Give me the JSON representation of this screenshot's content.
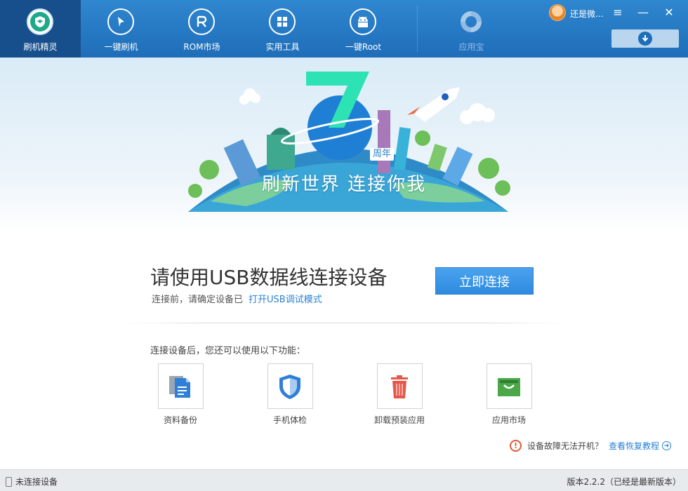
{
  "nav": {
    "items": [
      {
        "label": "刷机精灵",
        "icon": "shield-icon",
        "active": true
      },
      {
        "label": "一键刷机",
        "icon": "cursor-icon"
      },
      {
        "label": "ROM市场",
        "icon": "rom-icon"
      },
      {
        "label": "实用工具",
        "icon": "grid-icon"
      },
      {
        "label": "一键Root",
        "icon": "android-icon"
      },
      {
        "label": "应用宝",
        "icon": "app-store-icon",
        "disabled": true
      }
    ]
  },
  "user": {
    "name": "还是微..."
  },
  "window": {
    "menu": "≡",
    "minimize": "—",
    "close": "✕"
  },
  "banner": {
    "slogan": "刷新世界 连接你我",
    "anniversary_label": "周年",
    "anniversary_number": "7"
  },
  "connect": {
    "title": "请使用USB数据线连接设备",
    "subtitle": "连接前，请确定设备已",
    "link": "打开USB调试模式",
    "button": "立即连接"
  },
  "features": {
    "heading": "连接设备后，您还可以使用以下功能：",
    "items": [
      {
        "label": "资料备份",
        "icon": "document-backup-icon"
      },
      {
        "label": "手机体检",
        "icon": "shield-check-icon"
      },
      {
        "label": "卸载预装应用",
        "icon": "trash-icon"
      },
      {
        "label": "应用市场",
        "icon": "shopping-bag-icon"
      }
    ]
  },
  "help": {
    "text": "设备故障无法开机？",
    "link": "查看恢复教程"
  },
  "status": {
    "left": "未连接设备",
    "right": "版本2.2.2（已经是最新版本）"
  },
  "colors": {
    "header": "#1f6db9",
    "accent": "#2e8ae0",
    "link": "#2a82d4"
  }
}
